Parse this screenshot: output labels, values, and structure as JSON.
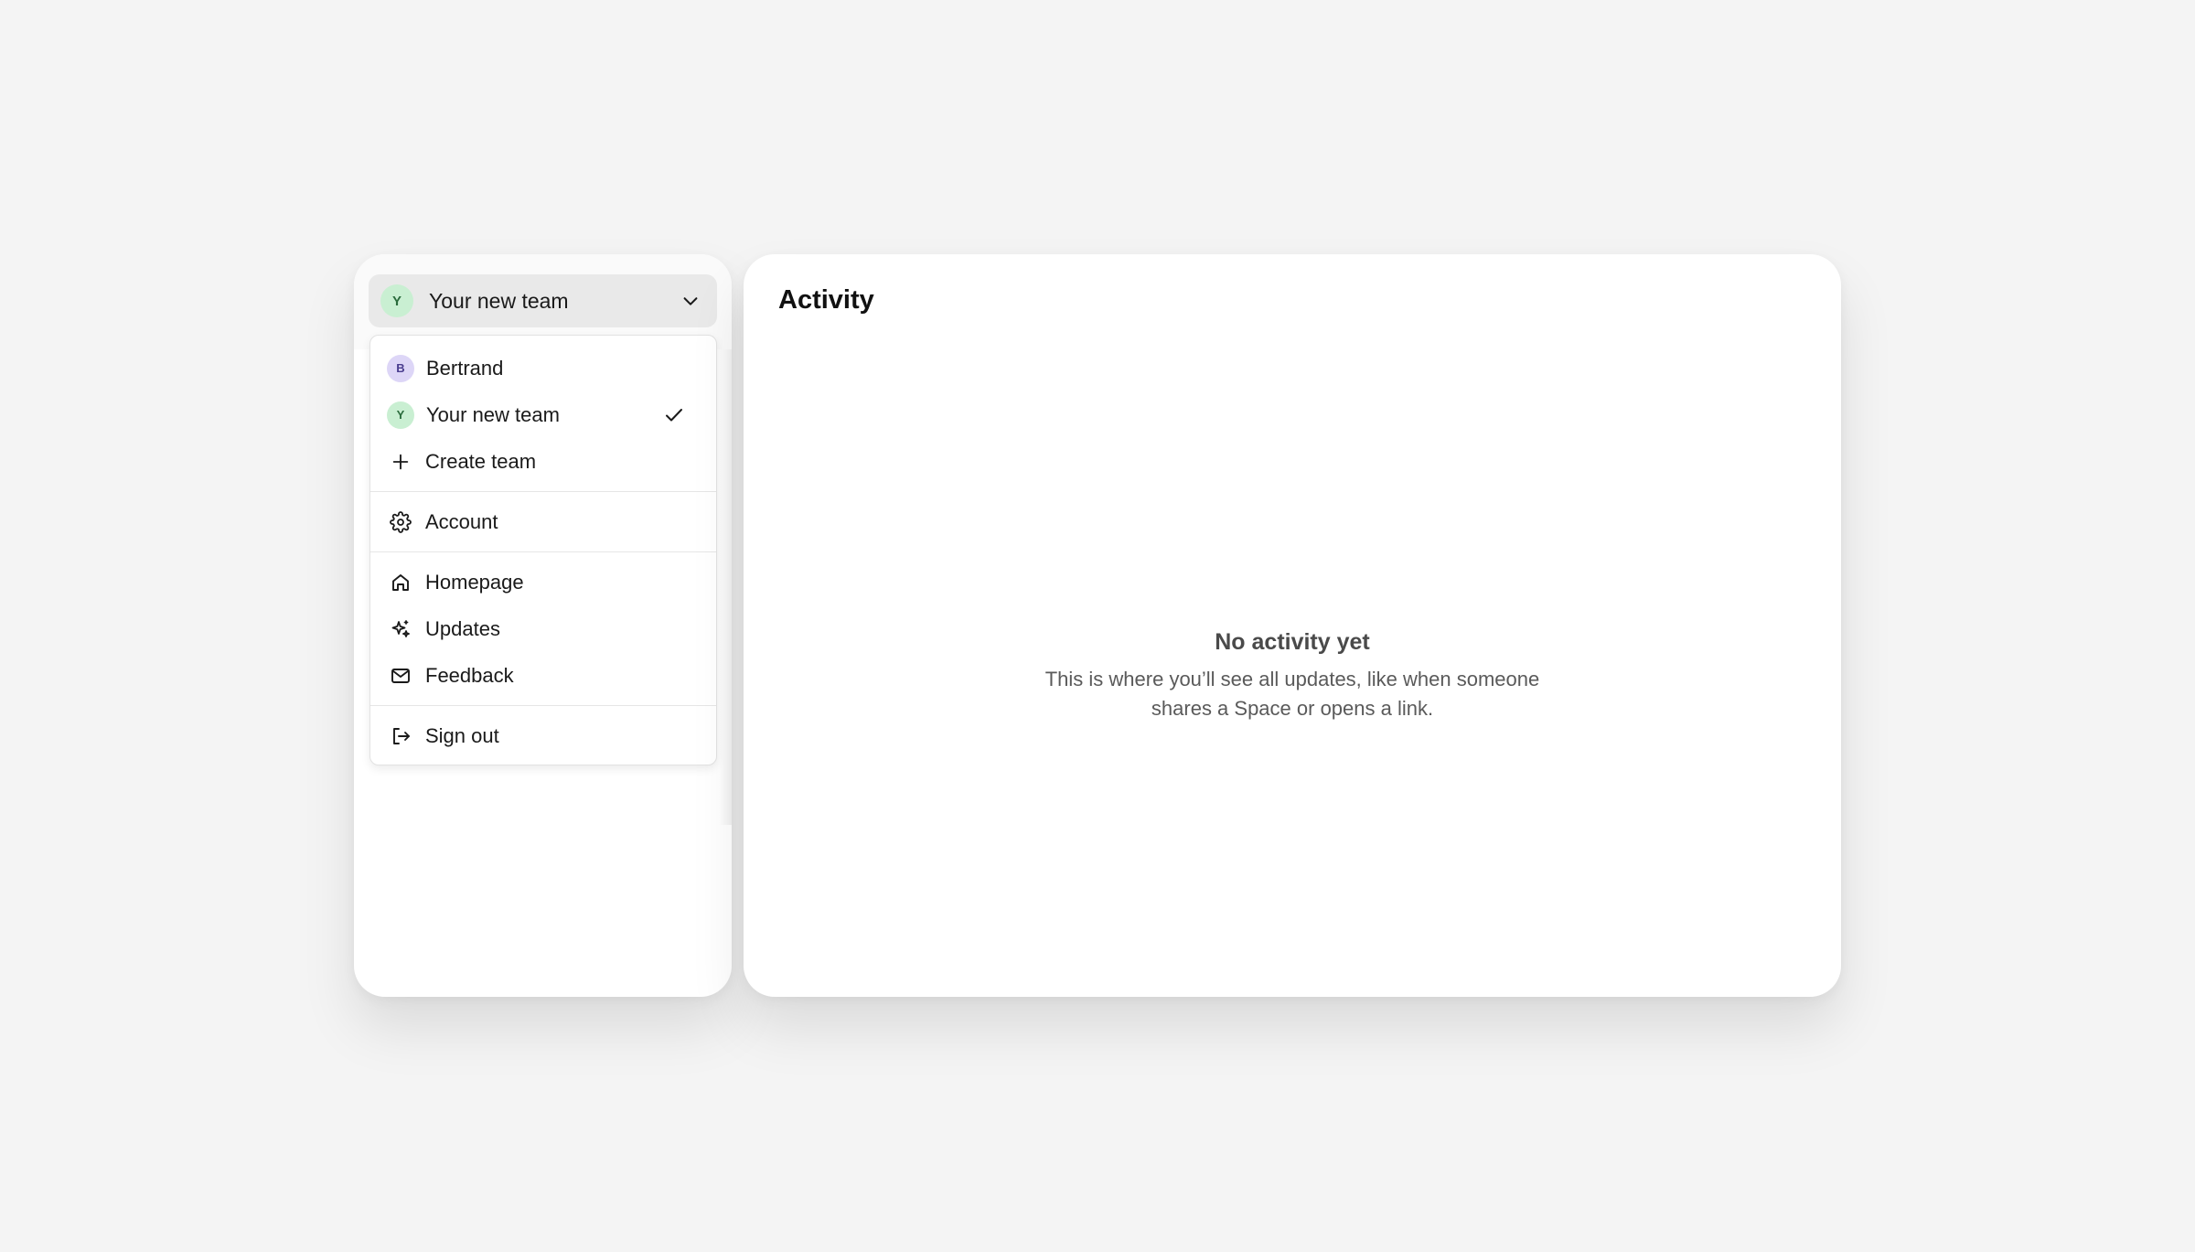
{
  "sidebar": {
    "team_switcher": {
      "avatar_letter": "Y",
      "label": "Your new team"
    },
    "menu": {
      "teams": [
        {
          "avatar_letter": "B",
          "label": "Bertrand",
          "avatar_color": "#ddd6f7",
          "selected": false
        },
        {
          "avatar_letter": "Y",
          "label": "Your new team",
          "avatar_color": "#c9efd2",
          "selected": true
        }
      ],
      "create_team_label": "Create team",
      "account_label": "Account",
      "homepage_label": "Homepage",
      "updates_label": "Updates",
      "feedback_label": "Feedback",
      "sign_out_label": "Sign out"
    }
  },
  "main": {
    "title": "Activity",
    "empty_state": {
      "title": "No activity yet",
      "description": "This is where you’ll see all updates, like when someone shares a Space or opens a link."
    }
  },
  "icons": {
    "chevron": "chevron-down-icon",
    "check": "check-icon",
    "plus": "plus-icon",
    "account": "gear-icon",
    "homepage": "home-icon",
    "updates": "sparkles-icon",
    "feedback": "mail-icon",
    "sign_out": "sign-out-icon"
  },
  "colors": {
    "background": "#f4f4f4",
    "switcher_bg": "#e9e9e9",
    "avatar_green": "#c9efd2",
    "avatar_purple": "#ddd6f7"
  }
}
